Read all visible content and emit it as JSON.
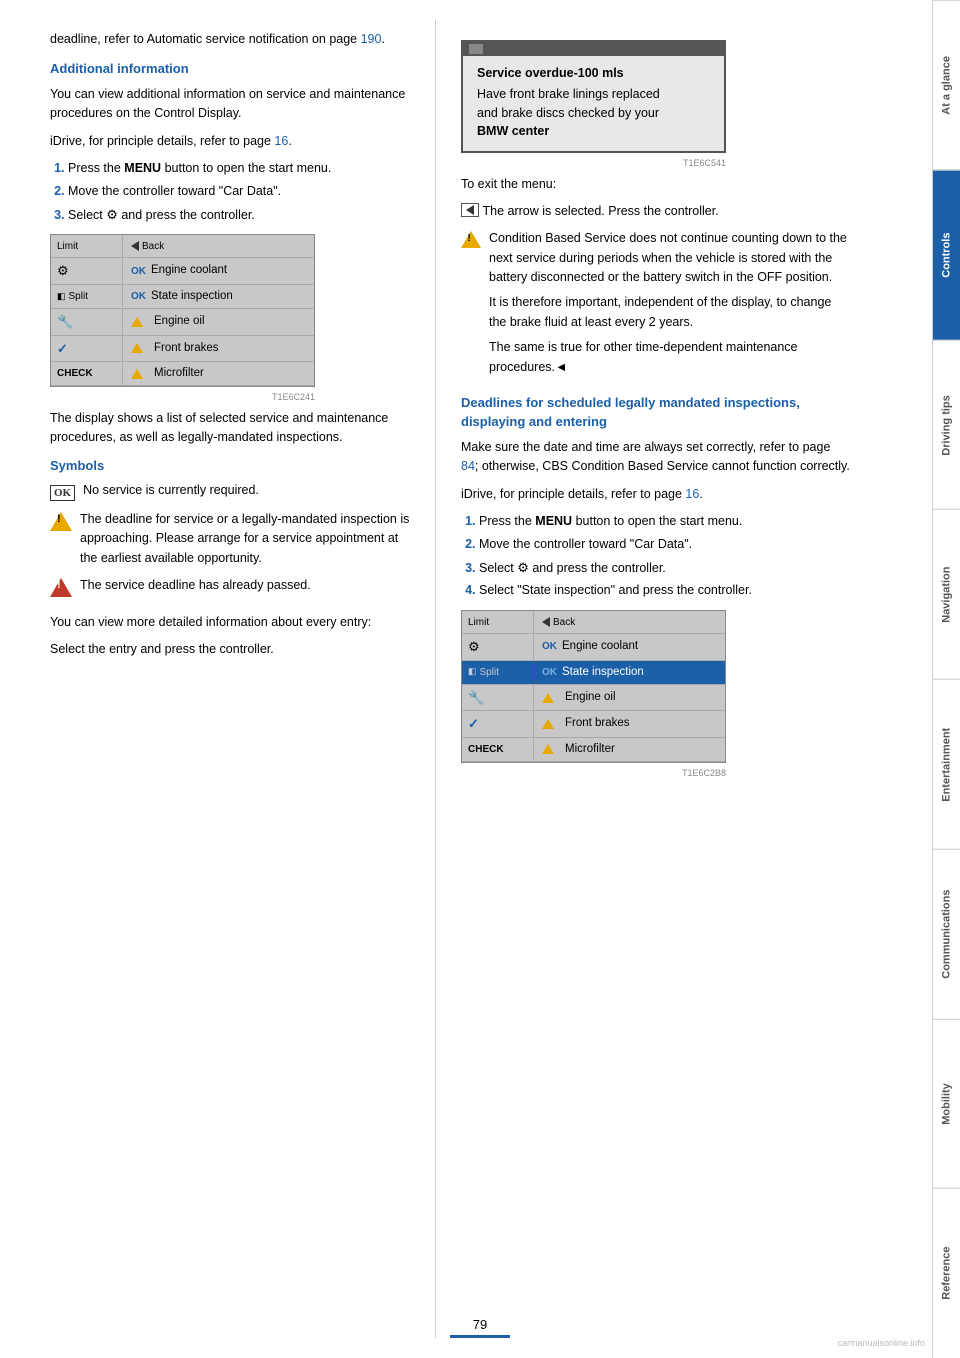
{
  "page": {
    "number": "79",
    "watermark": "carmanualsonline.info"
  },
  "sidebar": {
    "tabs": [
      {
        "label": "At a glance",
        "active": false
      },
      {
        "label": "Controls",
        "active": true
      },
      {
        "label": "Driving tips",
        "active": false
      },
      {
        "label": "Navigation",
        "active": false
      },
      {
        "label": "Entertainment",
        "active": false
      },
      {
        "label": "Communications",
        "active": false
      },
      {
        "label": "Mobility",
        "active": false
      },
      {
        "label": "Reference",
        "active": false
      }
    ]
  },
  "left_col": {
    "intro": "deadline, refer to Automatic service notification on page 190.",
    "intro_link": "190",
    "section1_title": "Additional information",
    "section1_para1": "You can view additional information on service and maintenance procedures on the Control Display.",
    "section1_idrive": "iDrive, for principle details, refer to page 16.",
    "section1_idrive_link": "16",
    "steps": [
      {
        "num": "1.",
        "text": "Press the ",
        "bold": "MENU",
        "text2": " button to open the start menu."
      },
      {
        "num": "2.",
        "text": "Move the controller toward \"Car Data\".",
        "bold": "",
        "text2": ""
      },
      {
        "num": "3.",
        "text": "Select ",
        "icon": "settings-icon",
        "text2": " and press the controller."
      }
    ],
    "menu1": {
      "rows": [
        {
          "left": "Limit",
          "left_icon": "back",
          "right": "Back",
          "right_icon": "",
          "highlight": false
        },
        {
          "left": "",
          "left_icon": "gear",
          "right": "Engine coolant",
          "right_prefix": "OK",
          "highlight": false
        },
        {
          "left": "Split",
          "left_icon": "split",
          "right": "State inspection",
          "right_prefix": "OK",
          "highlight": false
        },
        {
          "left": "",
          "left_icon": "route",
          "right": "Engine oil",
          "right_prefix": "warn",
          "highlight": false
        },
        {
          "left": "",
          "left_icon": "check",
          "right": "Front brakes",
          "right_prefix": "warn",
          "highlight": false
        },
        {
          "left": "CHECK",
          "left_icon": "",
          "right": "Microfilter",
          "right_prefix": "warn",
          "highlight": false
        }
      ],
      "fig_label": "T1E6C241"
    },
    "menu1_caption": "The display shows a list of selected service and maintenance procedures, as well as legally-mandated inspections.",
    "symbols_title": "Symbols",
    "sym1_text": "No service is currently required.",
    "sym2_text": "The deadline for service or a legally-mandated inspection is approaching. Please arrange for a service appointment at the earliest available opportunity.",
    "sym3_text": "The service deadline has already passed.",
    "sym_para1": "You can view more detailed information about every entry:",
    "sym_para2": "Select the entry and press the controller."
  },
  "right_col": {
    "service_box": {
      "header": "",
      "lines": [
        "Service overdue‑100 mls",
        "Have front brake linings replaced",
        "and brake discs checked by your",
        "BMW center"
      ],
      "fig_label": "T1E6C541"
    },
    "exit_text": "To exit the menu:",
    "exit_instruction": "The arrow is selected. Press the controller.",
    "caution_para1": "Condition Based Service does not continue counting down to the next service during periods when the vehicle is stored with the battery disconnected or the battery switch in the OFF position.",
    "caution_para2": "It is therefore important, independent of the display, to change the brake fluid at least every 2 years.",
    "caution_para3": "The same is true for other time-dependent maintenance procedures.◄",
    "section2_title": "Deadlines for scheduled legally mandated inspections, displaying and entering",
    "section2_para1": "Make sure the date and time are always set correctly, refer to page 84; otherwise, CBS Condition Based Service cannot function correctly.",
    "section2_para1_link": "84",
    "section2_idrive": "iDrive, for principle details, refer to page 16.",
    "section2_idrive_link": "16",
    "steps2": [
      {
        "num": "1.",
        "text": "Press the ",
        "bold": "MENU",
        "text2": " button to open the start menu."
      },
      {
        "num": "2.",
        "text": "Move the controller toward \"Car Data\".",
        "bold": "",
        "text2": ""
      },
      {
        "num": "3.",
        "text": "Select ",
        "icon": "settings-icon",
        "text2": " and press the controller."
      },
      {
        "num": "4.",
        "text": "Select \"State inspection\" and press the controller.",
        "bold": "",
        "text2": ""
      }
    ],
    "menu2": {
      "rows": [
        {
          "left": "Limit",
          "left_icon": "back",
          "right": "Back",
          "right_icon": "",
          "highlight": false
        },
        {
          "left": "",
          "left_icon": "gear",
          "right": "Engine coolant",
          "right_prefix": "OK",
          "highlight": false
        },
        {
          "left": "Split",
          "left_icon": "split",
          "right": "State inspection",
          "right_prefix": "OK",
          "highlight": true
        },
        {
          "left": "",
          "left_icon": "route",
          "right": "Engine oil",
          "right_prefix": "warn",
          "highlight": false
        },
        {
          "left": "",
          "left_icon": "check",
          "right": "Front brakes",
          "right_prefix": "warn",
          "highlight": false
        },
        {
          "left": "CHECK",
          "left_icon": "",
          "right": "Microfilter",
          "right_prefix": "warn",
          "highlight": false
        }
      ],
      "fig_label": "T1E6C2B8"
    }
  }
}
